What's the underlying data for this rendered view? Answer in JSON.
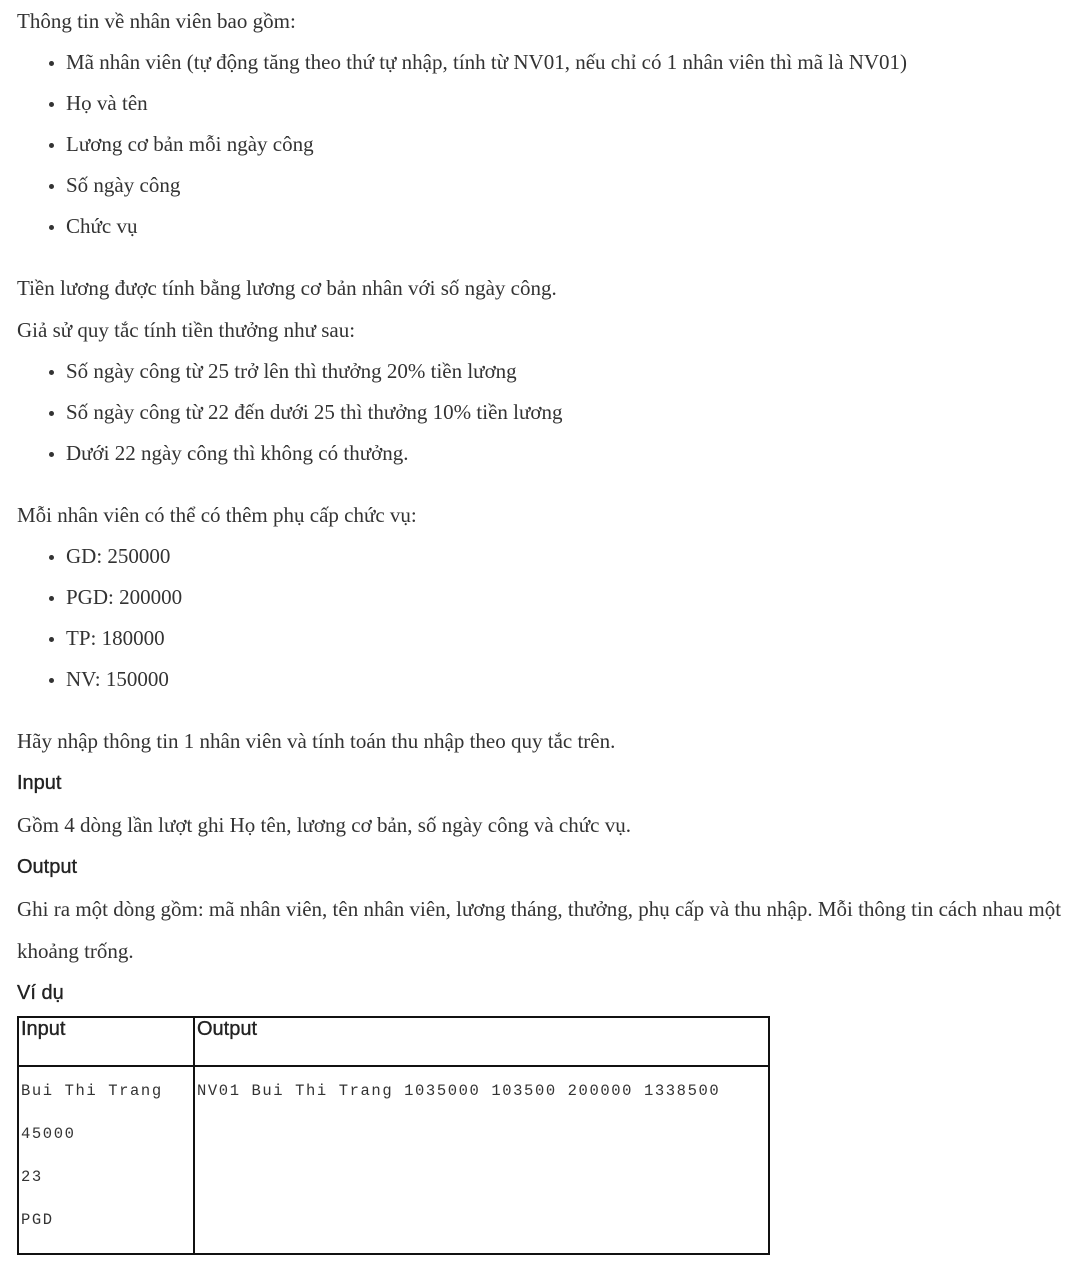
{
  "intro": "Thông tin về nhân viên bao gồm:",
  "fields": [
    "Mã nhân viên (tự động tăng theo thứ tự nhập, tính từ NV01, nếu chỉ có 1 nhân viên thì mã là NV01)",
    "Họ và tên",
    "Lương cơ bản mỗi ngày công",
    "Số ngày công",
    "Chức vụ"
  ],
  "salary_rule": "Tiền lương được tính bằng lương cơ bản nhân với số ngày công.",
  "bonus_intro": "Giả sử quy tắc tính tiền thưởng như sau:",
  "bonus_rules": [
    "Số ngày công từ 25 trở lên thì thưởng 20% tiền lương",
    "Số ngày công từ 22 đến dưới 25 thì thưởng 10% tiền lương",
    "Dưới 22 ngày công thì không có thưởng."
  ],
  "allowance_intro": "Mỗi nhân viên có thể có thêm phụ cấp chức vụ:",
  "allowances": [
    "GD: 250000",
    "PGD: 200000",
    "TP: 180000",
    "NV: 150000"
  ],
  "task": "Hãy nhập thông tin 1 nhân viên và tính toán thu nhập theo quy tắc trên.",
  "input_heading": "Input",
  "input_desc": "Gồm 4 dòng lần lượt ghi Họ tên, lương cơ bản, số ngày công và chức vụ.",
  "output_heading": "Output",
  "output_desc": "Ghi ra một dòng gồm: mã nhân viên, tên nhân viên, lương tháng, thưởng, phụ cấp và thu nhập. Mỗi thông tin cách nhau một khoảng trống.",
  "example_heading": "Ví dụ",
  "example": {
    "col_input": "Input",
    "col_output": "Output",
    "input_lines": [
      "Bui Thi Trang",
      "45000",
      "23",
      "PGD"
    ],
    "output_line": "NV01 Bui Thi Trang 1035000 103500 200000 1338500"
  }
}
